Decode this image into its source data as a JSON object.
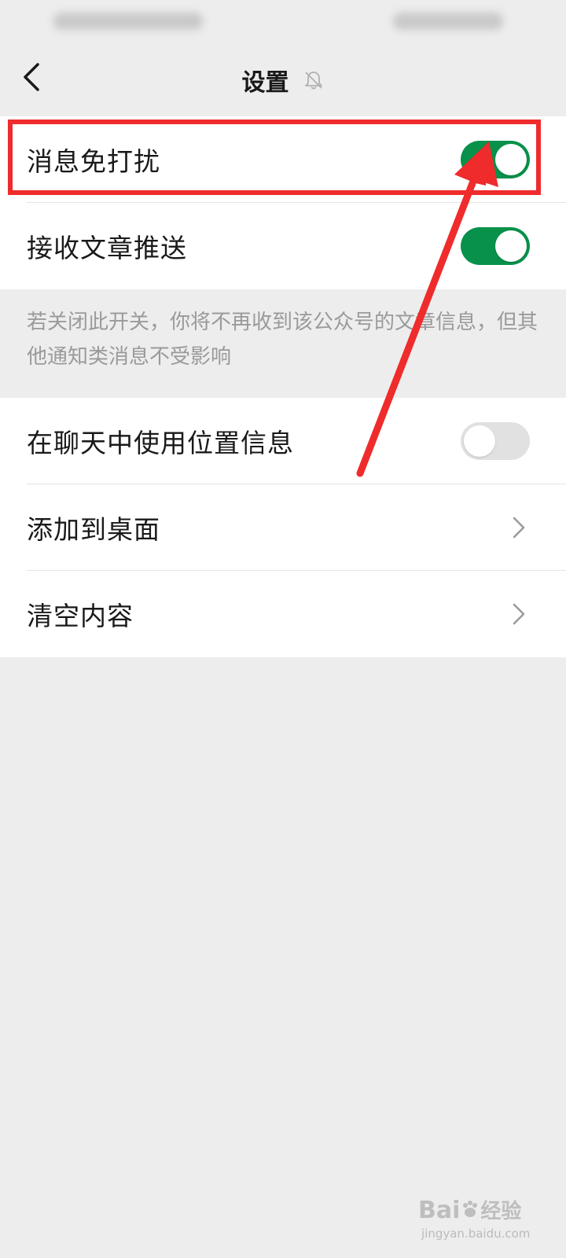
{
  "nav": {
    "title": "设置"
  },
  "group1": {
    "dnd_label": "消息免打扰",
    "dnd_on": true,
    "receive_label": "接收文章推送",
    "receive_on": true
  },
  "description": "若关闭此开关，你将不再收到该公众号的文章信息，但其他通知类消息不受影响",
  "group2": {
    "location_label": "在聊天中使用位置信息",
    "location_on": false,
    "add_desktop_label": "添加到桌面",
    "clear_label": "清空内容"
  },
  "watermark": {
    "brand": "Bai",
    "brand_suffix": "经验",
    "url": "jingyan.baidu.com"
  },
  "colors": {
    "toggle_on": "#07914a",
    "toggle_off": "#e1e1e1",
    "annotation_red": "#ef2b2b",
    "background": "#ededed"
  },
  "icons": [
    "back-arrow-icon",
    "bell-muted-icon",
    "chevron-right-icon",
    "baidu-paw-icon"
  ]
}
